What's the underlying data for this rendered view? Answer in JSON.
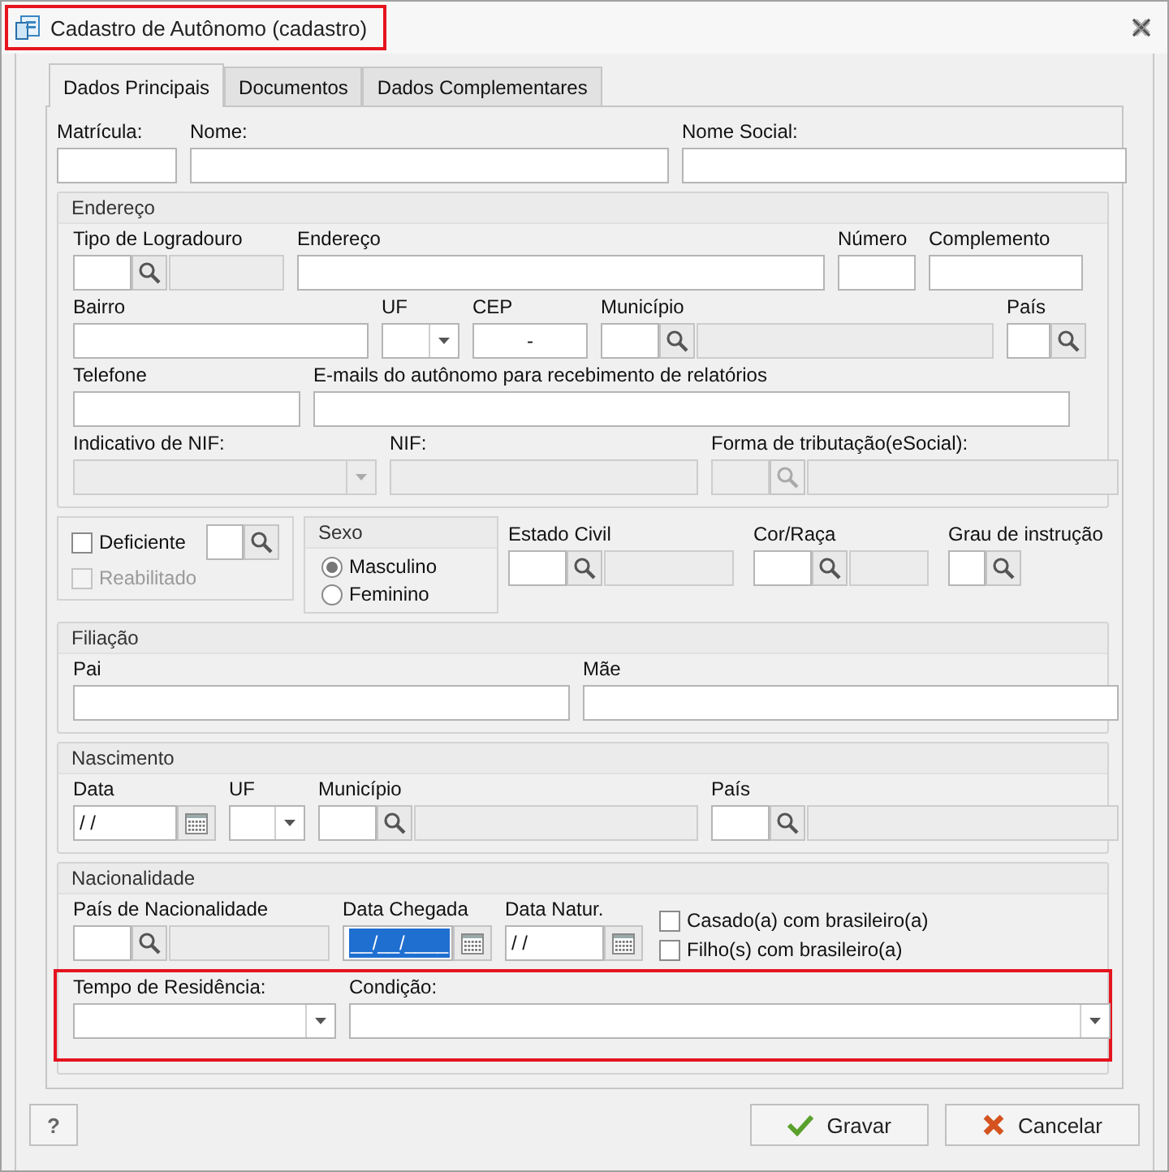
{
  "window": {
    "title": "Cadastro de Autônomo (cadastro)",
    "title_highlighted": true
  },
  "tabs": [
    {
      "label": "Dados Principais",
      "selected": true
    },
    {
      "label": "Documentos",
      "selected": false
    },
    {
      "label": "Dados Complementares",
      "selected": false
    }
  ],
  "top_fields": [
    {
      "label": "Matrícula:",
      "kind": "text",
      "disabled": false
    },
    {
      "label": "Nome:",
      "kind": "text",
      "disabled": false
    },
    {
      "label": "Nome Social:",
      "kind": "text",
      "disabled": false
    }
  ],
  "sections": [
    {
      "kind": "fieldset",
      "title": "Endereço",
      "rows": [
        {
          "highlighted": false,
          "fields": [
            {
              "label": "Tipo de Logradouro",
              "kind": "lookup",
              "disabled": false
            },
            {
              "label": "Endereço",
              "kind": "text",
              "disabled": false
            },
            {
              "label": "Número",
              "kind": "text",
              "disabled": false
            },
            {
              "label": "Complemento",
              "kind": "text",
              "disabled": false
            }
          ]
        },
        {
          "highlighted": false,
          "fields": [
            {
              "label": "Bairro",
              "kind": "text",
              "disabled": false
            },
            {
              "label": "UF",
              "kind": "select",
              "disabled": false
            },
            {
              "label": "CEP",
              "kind": "text",
              "value": "-",
              "disabled": false
            },
            {
              "label": "Município",
              "kind": "lookup",
              "disabled": false
            },
            {
              "label": "País",
              "kind": "lookup_short",
              "disabled": false
            }
          ]
        },
        {
          "highlighted": false,
          "fields": [
            {
              "label": "Telefone",
              "kind": "text",
              "disabled": false
            },
            {
              "label": "E-mails do autônomo para recebimento de relatórios",
              "kind": "text",
              "disabled": false
            }
          ]
        },
        {
          "highlighted": false,
          "fields": [
            {
              "label": "Indicativo de NIF:",
              "kind": "select",
              "disabled": true
            },
            {
              "label": "NIF:",
              "kind": "text",
              "disabled": true
            },
            {
              "label": "Forma de tributação(eSocial):",
              "kind": "lookup",
              "disabled": true
            }
          ]
        }
      ]
    },
    {
      "kind": "personal",
      "checks": [
        {
          "label": "Deficiente",
          "checked": false,
          "disabled": false
        },
        {
          "label": "Reabilitado",
          "checked": false,
          "disabled": true
        }
      ],
      "disability_lookup": {
        "kind": "lookup_short",
        "disabled": false
      },
      "sex": {
        "title": "Sexo",
        "options": [
          {
            "label": "Masculino",
            "selected": true
          },
          {
            "label": "Feminino",
            "selected": false
          }
        ]
      },
      "fields": [
        {
          "label": "Estado Civil",
          "kind": "lookup",
          "disabled": false
        },
        {
          "label": "Cor/Raça",
          "kind": "lookup",
          "disabled": false
        },
        {
          "label": "Grau de instrução",
          "kind": "lookup_short",
          "disabled": false
        }
      ]
    },
    {
      "kind": "fieldset",
      "title": "Filiação",
      "rows": [
        {
          "highlighted": false,
          "fields": [
            {
              "label": "Pai",
              "kind": "text",
              "disabled": false
            },
            {
              "label": "Mãe",
              "kind": "text",
              "disabled": false
            }
          ]
        }
      ]
    },
    {
      "kind": "fieldset",
      "title": "Nascimento",
      "rows": [
        {
          "highlighted": false,
          "fields": [
            {
              "label": "Data",
              "kind": "date",
              "value": "/ /",
              "value_selected": false,
              "disabled": false
            },
            {
              "label": "UF",
              "kind": "select",
              "disabled": false
            },
            {
              "label": "Município",
              "kind": "lookup",
              "disabled": false
            },
            {
              "label": "País",
              "kind": "lookup",
              "disabled": false
            }
          ]
        }
      ]
    },
    {
      "kind": "fieldset",
      "title": "Nacionalidade",
      "rows": [
        {
          "highlighted": false,
          "fields": [
            {
              "label": "País de Nacionalidade",
              "kind": "lookup",
              "disabled": false
            },
            {
              "label": "Data Chegada",
              "kind": "date",
              "value": "__/__/____",
              "value_selected": true,
              "disabled": false
            },
            {
              "label": "Data Natur.",
              "kind": "date",
              "value": "/ /",
              "value_selected": false,
              "disabled": false
            }
          ],
          "checks": [
            {
              "label": "Casado(a) com brasileiro(a)",
              "checked": false,
              "disabled": false
            },
            {
              "label": "Filho(s) com brasileiro(a)",
              "checked": false,
              "disabled": false
            }
          ]
        },
        {
          "highlighted": true,
          "fields": [
            {
              "label": "Tempo de Residência:",
              "kind": "select",
              "disabled": false
            },
            {
              "label": "Condição:",
              "kind": "select",
              "disabled": false
            }
          ]
        }
      ]
    }
  ],
  "buttons": [
    {
      "label": "?",
      "kind": "help"
    },
    {
      "label": "Gravar",
      "kind": "save"
    },
    {
      "label": "Cancelar",
      "kind": "cancel"
    }
  ]
}
